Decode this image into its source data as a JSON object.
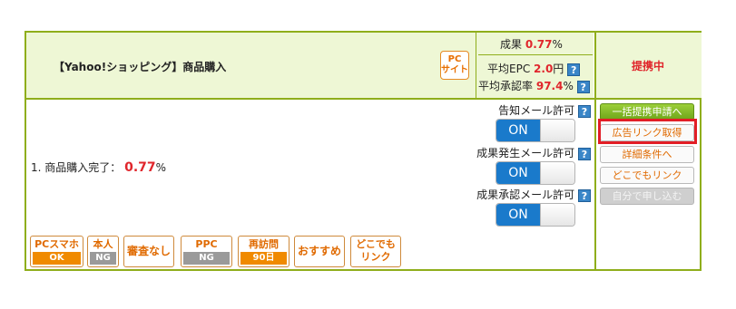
{
  "program": {
    "title": "【Yahoo!ショッピング】商品購入",
    "pc_badge": [
      "PC",
      "サイト"
    ],
    "status": "提携中"
  },
  "stats": {
    "result_label": "成果",
    "result_value": "0.77",
    "result_unit": "%",
    "epc_label": "平均EPC",
    "epc_value": "2.0",
    "epc_unit": "円",
    "approval_label": "平均承認率",
    "approval_value": "97.4",
    "approval_unit": "%"
  },
  "help_icon": "?",
  "toggles": [
    {
      "label": "告知メール許可",
      "state": "ON"
    },
    {
      "label": "成果発生メール許可",
      "state": "ON"
    },
    {
      "label": "成果承認メール許可",
      "state": "ON"
    }
  ],
  "condition": {
    "text": "1. 商品購入完了：",
    "value": "0.77",
    "unit": "%"
  },
  "tags": [
    {
      "top": "PCスマホ",
      "bottom": "OK",
      "bottom_style": "ok"
    },
    {
      "top": "本人",
      "bottom": "NG",
      "bottom_style": "ng"
    },
    {
      "top": "審査なし"
    },
    {
      "top": "PPC",
      "bottom": "NG",
      "bottom_style": "ng"
    },
    {
      "top": "再訪問",
      "bottom": "90日",
      "bottom_style": "ok"
    },
    {
      "top": "おすすめ"
    },
    {
      "top": "どこでも\nリンク"
    }
  ],
  "buttons": {
    "bulk_apply": "一括提携申請へ",
    "get_ad_link": "広告リンク取得",
    "details": "詳細条件へ",
    "anywhere_link": "どこでもリンク",
    "self_apply": "自分で申し込む"
  },
  "colors": {
    "border_green": "#8fae1b",
    "header_bg": "#eef7d5",
    "accent_red": "#e0262c",
    "toggle_blue": "#1a7acb",
    "tag_orange": "#e06a00",
    "highlight_red": "#e21e26"
  }
}
